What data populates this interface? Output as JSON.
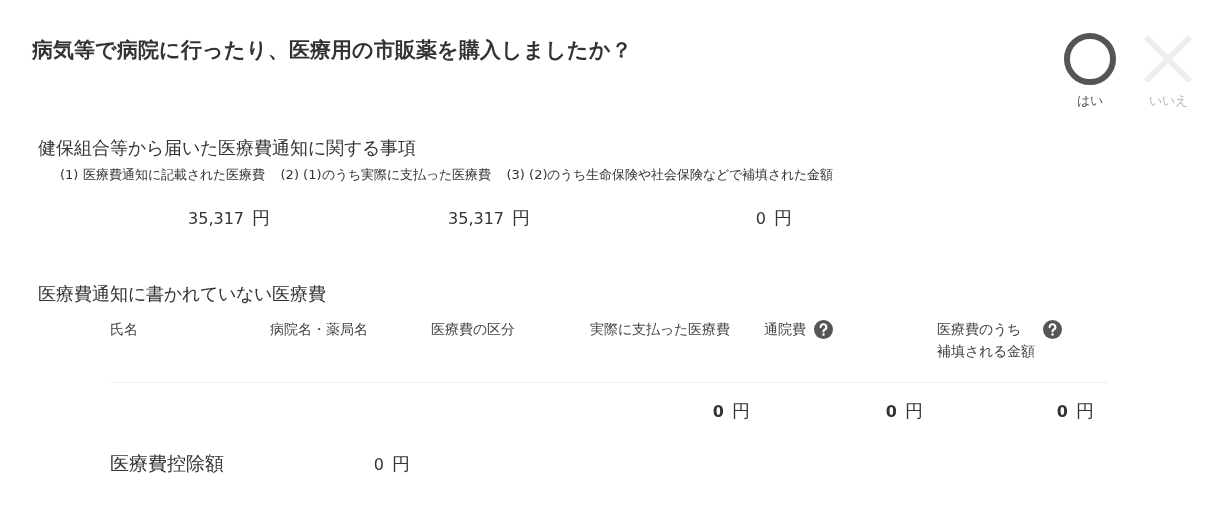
{
  "question": {
    "title": "病気等で病院に行ったり、医療用の市販薬を購入しましたか？",
    "answers": [
      {
        "kind": "yes",
        "label": "はい",
        "selected": true
      },
      {
        "kind": "no",
        "label": "いいえ",
        "selected": false
      }
    ]
  },
  "notice_section": {
    "heading": "健保組合等から届いた医療費通知に関する事項",
    "columns": [
      {
        "label": "(1) 医療費通知に記載された医療費",
        "amount": "35,317",
        "unit": "円"
      },
      {
        "label": "(2) (1)のうち実際に支払った医療費",
        "amount": "35,317",
        "unit": "円"
      },
      {
        "label": "(3) (2)のうち生命保険や社会保険などで補填された金額",
        "amount": "0",
        "unit": "円"
      }
    ]
  },
  "other_section": {
    "heading": "医療費通知に書かれていない医療費",
    "table": {
      "columns": [
        {
          "lines": [
            "氏名"
          ],
          "help": false
        },
        {
          "lines": [
            "病院名・薬局名"
          ],
          "help": false
        },
        {
          "lines": [
            "医療費の区分"
          ],
          "help": false
        },
        {
          "lines": [
            "実際に支払った医療費"
          ],
          "help": false,
          "total": {
            "amount": "0",
            "unit": "円"
          }
        },
        {
          "lines": [
            "通院費"
          ],
          "help": true,
          "total": {
            "amount": "0",
            "unit": "円"
          }
        },
        {
          "lines": [
            "医療費のうち",
            "補填される金額"
          ],
          "help": true,
          "total": {
            "amount": "0",
            "unit": "円"
          }
        }
      ]
    }
  },
  "deduction": {
    "label": "医療費控除額",
    "amount": "0",
    "unit": "円"
  }
}
